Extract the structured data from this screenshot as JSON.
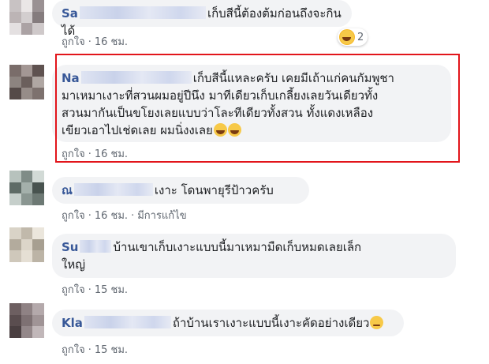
{
  "colors": {
    "name": "#385898",
    "bubble": "#f2f3f5",
    "meta": "#606770",
    "highlight": "#e2151b"
  },
  "comments": [
    {
      "name": "Sa",
      "text_lines": [
        "เก็บสีนี้ต้องต้มก่อนถึงจะกินได้"
      ],
      "like": "ถูกใจ",
      "time": "16 ชม.",
      "reaction": {
        "icon": "laughing-emoji-icon",
        "count": "2"
      },
      "avatar": [
        "#c8c2c3",
        "#eae6e6",
        "#9a9193",
        "#bcb4b5",
        "#d3cecf",
        "#857c7e",
        "#e4e0e1",
        "#aba2a4",
        "#cfc9ca"
      ]
    },
    {
      "name": "Na",
      "text_lines": [
        "เก็บสีนี้แหละครับ เคยมีเถ้าแก่คนกัมพูชา",
        "มาเหมาเงาะที่สวนผมอยู่ปีนึง มาทีเดียวเก็บเกลี้ยงเลยวันเดียวทั้ง",
        "สวนมากันเป็นขโยงเลยแบบว่าโละทีเดียวทั้งสวน ทั้งแดงเหลือง",
        "เขียวเอาไปเช่ดเลย ผมนิ่งงเลย"
      ],
      "like": "ถูกใจ",
      "time": "16 ชม.",
      "avatar": [
        "#7a6d6a",
        "#a39794",
        "#5f5250",
        "#8d8480",
        "#6b5f5c",
        "#b0a7a3",
        "#554a48",
        "#968c88",
        "#7d716e"
      ]
    },
    {
      "name": "ณ",
      "text_lines": [
        "เงาะ โดนพายุรีป้าวครับ"
      ],
      "like": "ถูกใจ",
      "time": "16 ชม.",
      "edited": "มีการแก้ไข",
      "avatar": [
        "#b7c2bd",
        "#7f8c87",
        "#d2dad6",
        "#5e6b66",
        "#a4b0ab",
        "#48534f",
        "#c6cfcb",
        "#8a9691",
        "#6d7974"
      ]
    },
    {
      "name": "Su",
      "text_lines": [
        "บ้านเขาเก็บเงาะแบบนี้มาเหมามืดเก็บหมดเลยเล็ก",
        "ใหญ่"
      ],
      "like": "ถูกใจ",
      "time": "15 ชม.",
      "avatar": [
        "#d9d3c7",
        "#c1b9ab",
        "#ebe6dc",
        "#b3ab9d",
        "#dcd5c9",
        "#a79f91",
        "#cfc8bb",
        "#e5dfd4",
        "#bcb4a6"
      ]
    },
    {
      "name": "Kla",
      "text_lines": [
        "ถ้าบ้านเราเงาะแบบนี้เงาะคัดอย่างเดียว"
      ],
      "like": "ถูกใจ",
      "time": "15 ชม.",
      "avatar": [
        "#6d5f61",
        "#8f8284",
        "#b4a9ab",
        "#5a4d4f",
        "#7e7173",
        "#a09496",
        "#4a3f41",
        "#938789",
        "#c1b7b9"
      ]
    }
  ]
}
